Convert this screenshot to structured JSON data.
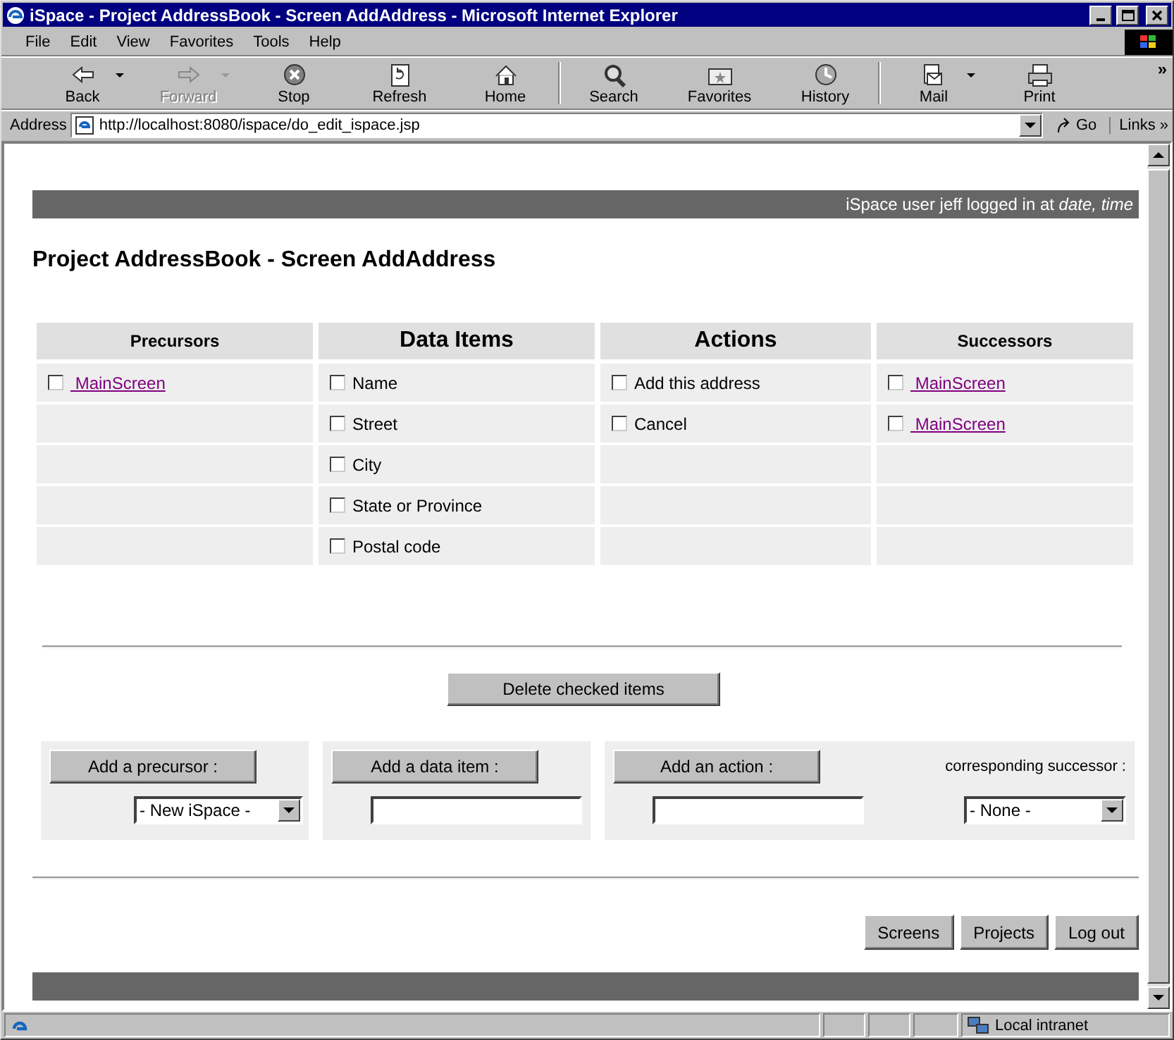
{
  "window": {
    "title": "iSpace - Project AddressBook - Screen AddAddress - Microsoft Internet Explorer"
  },
  "menu": [
    "File",
    "Edit",
    "View",
    "Favorites",
    "Tools",
    "Help"
  ],
  "toolbar": [
    {
      "kind": "back",
      "label": "Back",
      "disabled": false,
      "dropdown": true
    },
    {
      "kind": "forward",
      "label": "Forward",
      "disabled": true,
      "dropdown": true
    },
    {
      "kind": "stop",
      "label": "Stop",
      "disabled": false,
      "dropdown": false
    },
    {
      "kind": "refresh",
      "label": "Refresh",
      "disabled": false,
      "dropdown": false
    },
    {
      "kind": "home",
      "label": "Home",
      "disabled": false,
      "dropdown": false
    },
    {
      "kind": "search",
      "label": "Search",
      "disabled": false,
      "dropdown": false
    },
    {
      "kind": "favorites",
      "label": "Favorites",
      "disabled": false,
      "dropdown": false
    },
    {
      "kind": "history",
      "label": "History",
      "disabled": false,
      "dropdown": false
    },
    {
      "kind": "mail",
      "label": "Mail",
      "disabled": false,
      "dropdown": true
    },
    {
      "kind": "print",
      "label": "Print",
      "disabled": false,
      "dropdown": false
    }
  ],
  "toolbar_more": "»",
  "address_bar": {
    "label": "Address",
    "url": "http://localhost:8080/ispace/do_edit_ispace.jsp",
    "go": "Go",
    "links": "Links »"
  },
  "page": {
    "login_banner": "iSpace user jeff logged in at *date, time*",
    "heading": "Project AddressBook - Screen AddAddress",
    "columns": [
      {
        "title": "Precursors",
        "kind": "links",
        "items": [
          {
            "label": "MainScreen",
            "checked": false
          }
        ]
      },
      {
        "title": "Data Items",
        "kind": "items",
        "items": [
          {
            "label": "Name",
            "checked": false
          },
          {
            "label": "Street",
            "checked": false
          },
          {
            "label": "City",
            "checked": false
          },
          {
            "label": "State or Province",
            "checked": false
          },
          {
            "label": "Postal code",
            "checked": false
          }
        ]
      },
      {
        "title": "Actions",
        "kind": "items",
        "items": [
          {
            "label": "Add this address",
            "checked": false
          },
          {
            "label": "Cancel",
            "checked": false
          }
        ]
      },
      {
        "title": "Successors",
        "kind": "links",
        "items": [
          {
            "label": "MainScreen",
            "checked": false
          },
          {
            "label": "MainScreen",
            "checked": false
          }
        ]
      }
    ],
    "delete_button": "Delete checked items",
    "add_forms": [
      {
        "button": "Add a precursor :",
        "control": {
          "kind": "select",
          "value": "- New iSpace -"
        }
      },
      {
        "button": "Add a data item :",
        "control": {
          "kind": "text"
        }
      },
      {
        "button": "Add an action :",
        "control": {
          "kind": "text"
        },
        "successor": {
          "label": "corresponding successor :",
          "value": "- None -"
        }
      }
    ],
    "nav_buttons": [
      "Screens",
      "Projects",
      "Log out"
    ]
  },
  "status_bar": {
    "zone": "Local intranet"
  }
}
